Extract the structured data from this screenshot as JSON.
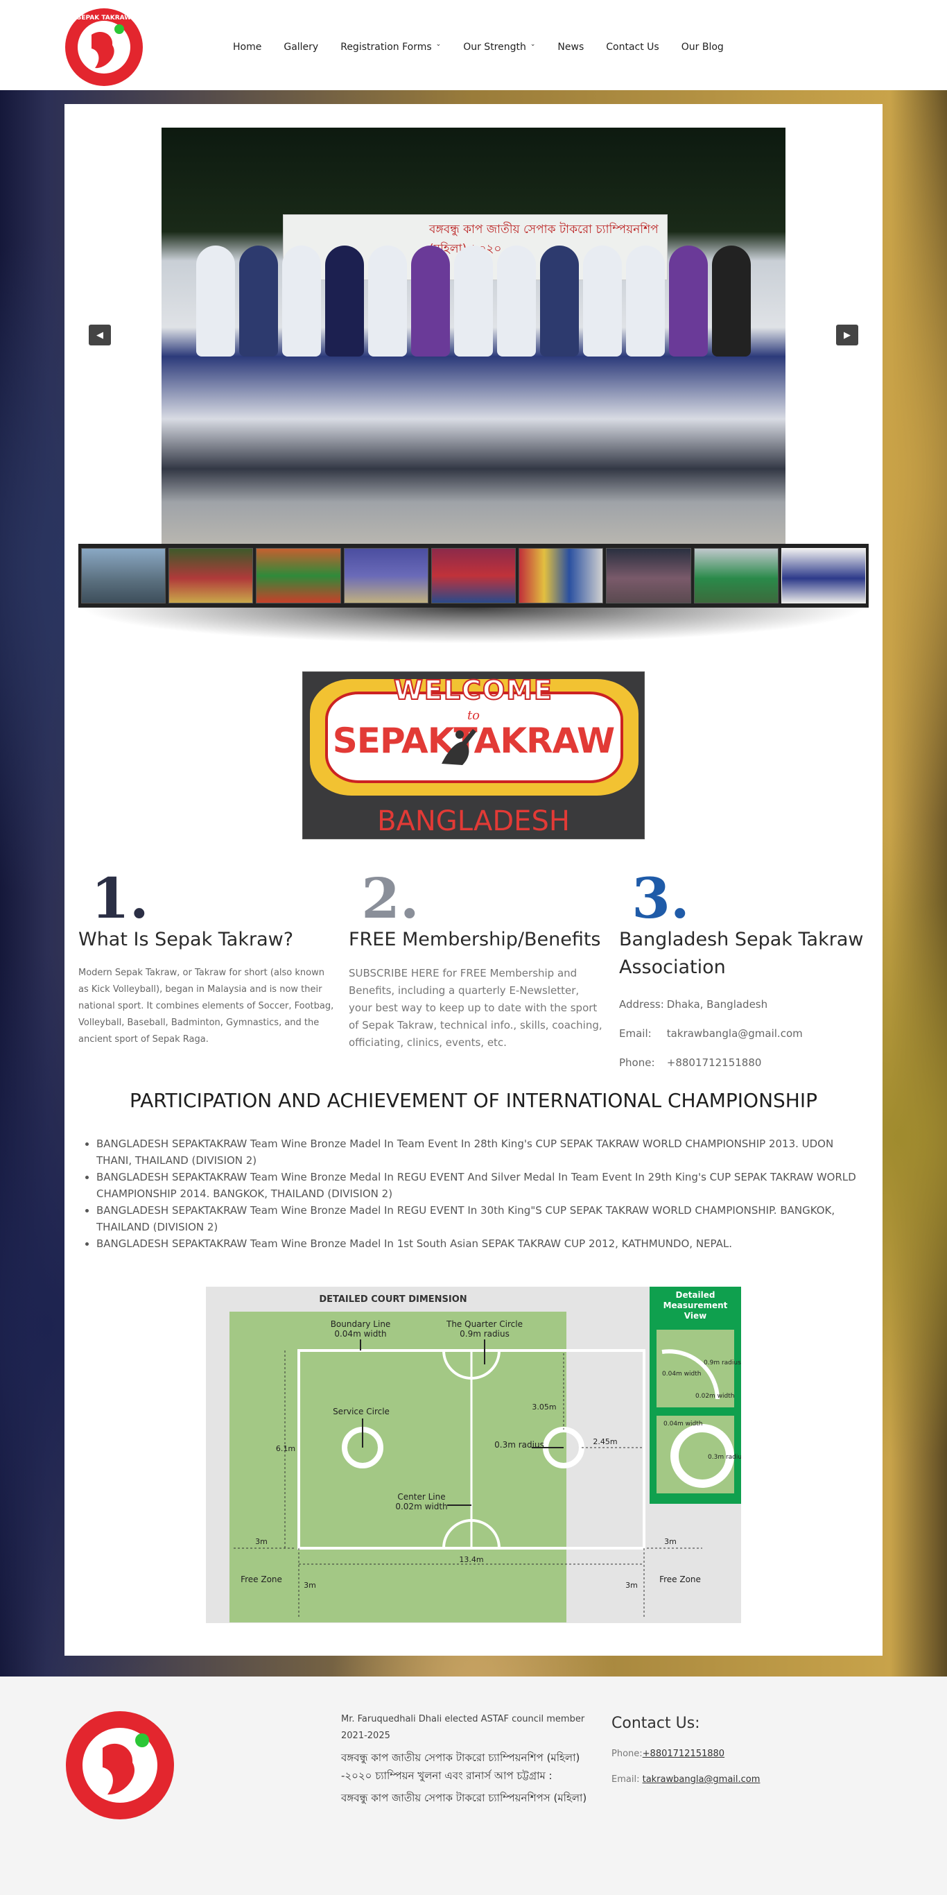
{
  "brand": {
    "logo_text": "SEPAK TAKRAW BANGLADESH",
    "colors": {
      "red": "#e3262e",
      "green": "#2bc636",
      "accent_blue": "#1f5ba8"
    }
  },
  "nav": {
    "items": [
      {
        "label": "Home",
        "dropdown": false
      },
      {
        "label": "Gallery",
        "dropdown": false
      },
      {
        "label": "Registration Forms",
        "dropdown": true
      },
      {
        "label": "Our Strength",
        "dropdown": true
      },
      {
        "label": "News",
        "dropdown": false
      },
      {
        "label": "Contact Us",
        "dropdown": false
      },
      {
        "label": "Our Blog",
        "dropdown": false
      }
    ]
  },
  "slider": {
    "banner_text": "বঙ্গবন্ধু কাপ জাতীয় সেপাক টাকরো চ্যাম্পিয়নশিপ (মহিলা)-২০২০",
    "prev_icon": "caret-left-icon",
    "next_icon": "caret-right-icon",
    "thumbnail_count": 9
  },
  "welcome": {
    "line1": "WELCOME",
    "line2": "to",
    "line3": "SEPAKTAKRAW",
    "line4": "BANGLADESH"
  },
  "features": [
    {
      "number": "1.",
      "title": "What Is Sepak Takraw?",
      "text": "Modern Sepak Takraw, or Takraw for short (also known as Kick Volleyball), began in Malaysia and is now their national sport. It combines elements of Soccer, Footbag, Volleyball, Baseball, Badminton, Gymnastics, and the ancient sport of Sepak Raga."
    },
    {
      "number": "2.",
      "title": "FREE Membership/Benefits",
      "text": "SUBSCRIBE HERE for FREE Membership and Benefits, including a quarterly E-Newsletter, your best way to keep up to date with the sport of Sepak Takraw, technical info., skills, coaching, officiating, clinics, events, etc."
    },
    {
      "number": "3.",
      "title": "Bangladesh Sepak Takraw Association",
      "address_label": "Address:",
      "address": "Dhaka, Bangladesh",
      "email_label": "Email:",
      "email": "takrawbangla@gmail.com",
      "phone_label": "Phone:",
      "phone": "+8801712151880"
    }
  ],
  "achievements": {
    "title": "PARTICIPATION AND ACHIEVEMENT OF INTERNATIONAL CHAMPIONSHIP",
    "items": [
      "BANGLADESH SEPAKTAKRAW Team Wine Bronze Madel In Team Event In 28th King's CUP SEPAK TAKRAW WORLD CHAMPIONSHIP 2013. UDON THANI, THAILAND (DIVISION 2)",
      "BANGLADESH SEPAKTAKRAW Team Wine Bronze Medal In REGU EVENT And Silver Medal In Team Event In 29th King's CUP SEPAK TAKRAW WORLD CHAMPIONSHIP 2014. BANGKOK, THAILAND (DIVISION 2)",
      "BANGLADESH SEPAKTAKRAW Team Wine Bronze Madel In REGU EVENT In 30th King\"S CUP SEPAK TAKRAW WORLD CHAMPIONSHIP. BANGKOK, THAILAND (DIVISION 2)",
      "BANGLADESH SEPAKTAKRAW Team Wine Bronze Madel In 1st South Asian SEPAK TAKRAW CUP 2012, KATHMUNDO, NEPAL."
    ]
  },
  "court": {
    "title": "DETAILED COURT DIMENSION",
    "side_title": "Detailed Measurement View",
    "boundary_label": "Boundary Line",
    "boundary_width": "0.04m width",
    "quarter_label": "The Quarter Circle",
    "quarter_radius": "0.9m radius",
    "service_label": "Service Circle",
    "center_label": "Center Line",
    "center_width": "0.02m width",
    "circle_radius": "0.3m radius",
    "dim_305": "3.05m",
    "dim_245": "2.45m",
    "dim_61": "6.1m",
    "dim_3m": "3m",
    "dim_134": "13.4m",
    "free_zone": "Free Zone",
    "detail_09": "0.9m radius",
    "detail_004": "0.04m width",
    "detail_002": "0.02m width",
    "detail_004b": "0.04m width",
    "detail_03": "0.3m radius"
  },
  "footer": {
    "news": [
      "Mr. Faruquedhali Dhali elected ASTAF council member 2021-2025",
      "বঙ্গবন্ধু কাপ জাতীয় সেপাক টাকরো চ্যাম্পিয়নশিপ (মহিলা) -২০২০ চ্যাম্পিয়ন খুলনা এবং রানার্স আপ চট্টগ্রাম :",
      "বঙ্গবন্ধু কাপ জাতীয় সেপাক টাকরো চ্যাম্পিয়নশিপস (মহিলা)"
    ],
    "contact_title": "Contact Us:",
    "phone_label": "Phone:",
    "phone": "+8801712151880",
    "email_label": "Email:",
    "email": "takrawbangla@gmail.com"
  }
}
